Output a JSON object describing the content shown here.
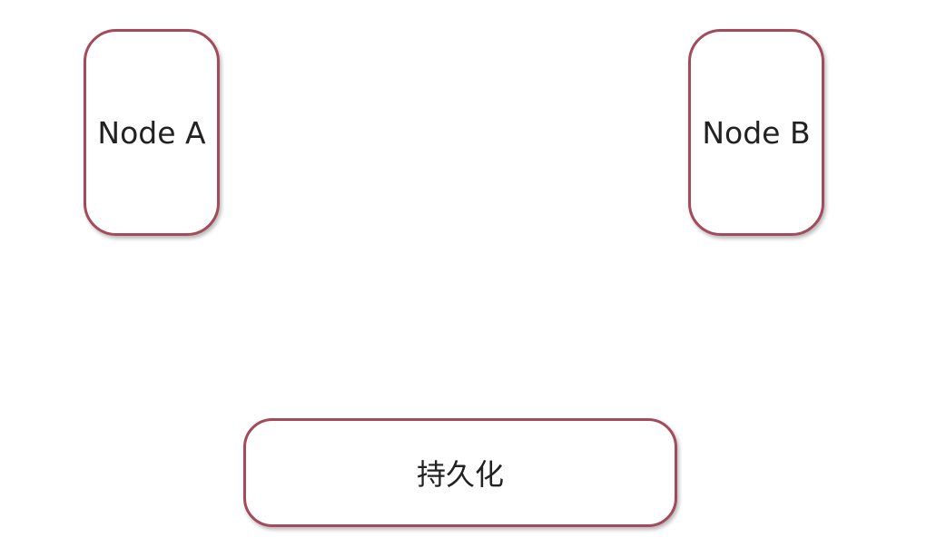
{
  "diagram": {
    "nodes": [
      {
        "id": "node_a",
        "label": "Node A"
      },
      {
        "id": "node_b",
        "label": "Node B"
      },
      {
        "id": "persistence",
        "label": "持久化"
      }
    ],
    "colors": {
      "border": "#a44a5a",
      "fill": "#ffffff",
      "text": "#222222"
    }
  }
}
